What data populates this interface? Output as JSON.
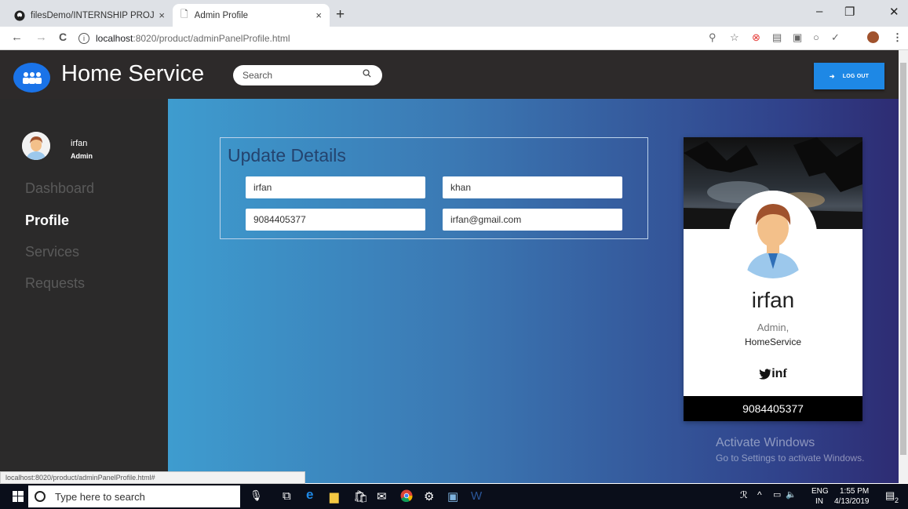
{
  "browser": {
    "tabs": [
      {
        "title": "filesDemo/INTERNSHIP PROJECT",
        "close": "×"
      },
      {
        "title": "Admin Profile",
        "close": "×"
      }
    ],
    "new_tab": "+",
    "window_controls": {
      "minimize": "–",
      "restore": "❐",
      "close": "✕"
    },
    "nav": {
      "back": "←",
      "forward": "→",
      "reload": "C"
    },
    "url_host": "localhost",
    "url_path": ":8020/product/adminPanelProfile.html",
    "status_url": "localhost:8020/product/adminPanelProfile.html#"
  },
  "header": {
    "title": "Home Service",
    "search_placeholder": "Search",
    "logout_label": "LOG OUT"
  },
  "sidebar": {
    "user_name": "irfan",
    "user_role": "Admin",
    "items": [
      {
        "label": "Dashboard",
        "active": false
      },
      {
        "label": "Profile",
        "active": true
      },
      {
        "label": "Services",
        "active": false
      },
      {
        "label": "Requests",
        "active": false
      }
    ]
  },
  "form": {
    "title": "Update Details",
    "first_name": "irfan",
    "last_name": "khan",
    "phone": "9084405377",
    "email": "irfan@gmail.com"
  },
  "card": {
    "name": "irfan",
    "role": "Admin,",
    "org": "HomeService",
    "phone": "9084405377"
  },
  "watermark": {
    "line1": "Activate Windows",
    "line2": "Go to Settings to activate Windows."
  },
  "taskbar": {
    "search_text": "Type here to search",
    "lang": "ENG",
    "region": "IN",
    "time": "1:55 PM",
    "date": "4/13/2019",
    "notifications": "2"
  },
  "colors": {
    "accent": "#1e88e5",
    "header_bg": "#2d2a2a",
    "sidebar_bg": "#2b2a2a"
  }
}
